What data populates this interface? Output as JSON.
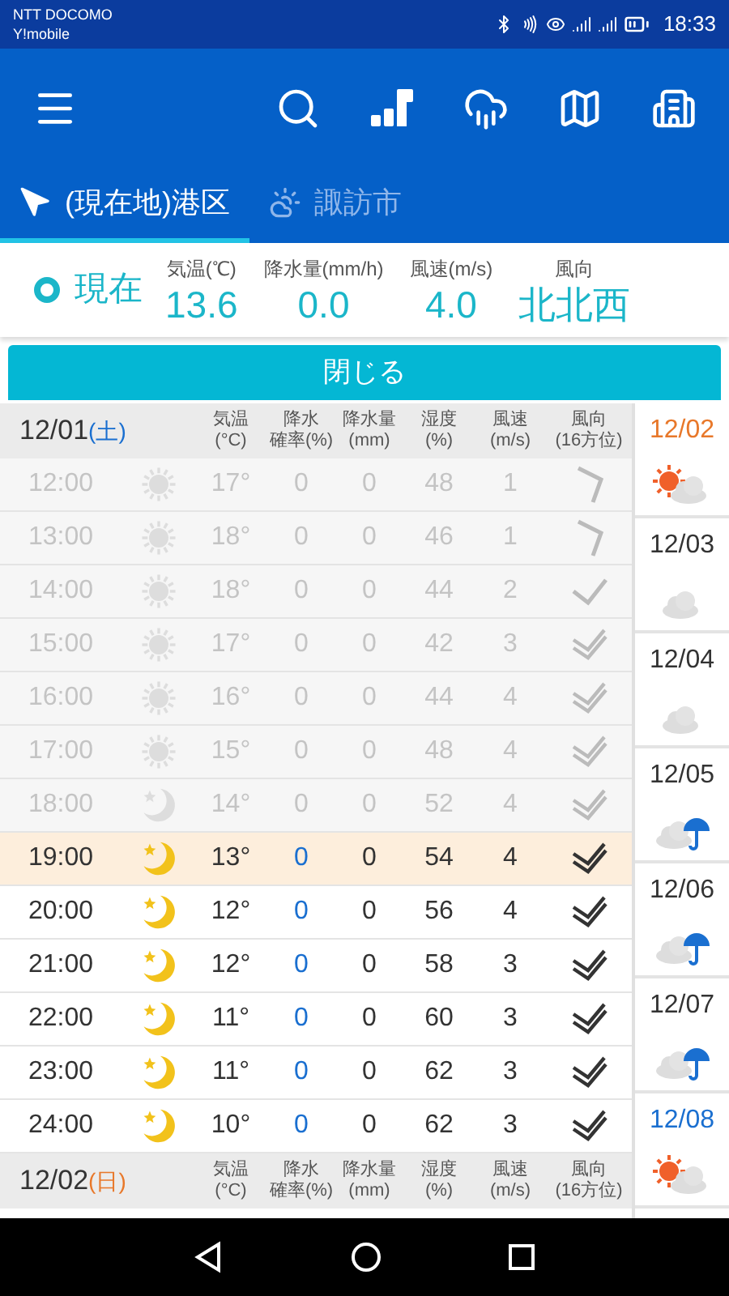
{
  "status_bar": {
    "carriers": [
      "NTT DOCOMO",
      "Y!mobile"
    ],
    "time": "18:33"
  },
  "location_tabs": [
    {
      "label": "(現在地)港区",
      "kind": "location",
      "selected": true
    },
    {
      "label": "諏訪市",
      "kind": "weather",
      "selected": false
    }
  ],
  "current": {
    "label": "現在",
    "metrics": [
      {
        "label": "気温(℃)",
        "value": "13.6"
      },
      {
        "label": "降水量(mm/h)",
        "value": "0.0"
      },
      {
        "label": "風速(m/s)",
        "value": "4.0"
      },
      {
        "label": "風向",
        "value": "北北西"
      }
    ]
  },
  "close_button": "閉じる",
  "table": {
    "heading": {
      "date": "12/01",
      "weekday": "(土)",
      "kind": "sat"
    },
    "columns": [
      [
        "気温",
        "(°C)"
      ],
      [
        "降水",
        "確率(%)"
      ],
      [
        "降水量",
        "(mm)"
      ],
      [
        "湿度",
        "(%)"
      ],
      [
        "風速",
        "(m/s)"
      ],
      [
        "風向",
        "(16方位)"
      ]
    ],
    "rows": [
      {
        "time": "12:00",
        "weather": {
          "kind": "sun"
        },
        "temp": "17°",
        "pop": "0",
        "precip": "0",
        "humidity": "48",
        "wind": "1",
        "wind_direction": {
          "kind": "chevron"
        },
        "past": true,
        "selected": false
      },
      {
        "time": "13:00",
        "weather": {
          "kind": "sun"
        },
        "temp": "18°",
        "pop": "0",
        "precip": "0",
        "humidity": "46",
        "wind": "1",
        "wind_direction": {
          "kind": "chevron"
        },
        "past": true,
        "selected": false
      },
      {
        "time": "14:00",
        "weather": {
          "kind": "sun"
        },
        "temp": "18°",
        "pop": "0",
        "precip": "0",
        "humidity": "44",
        "wind": "2",
        "wind_direction": {
          "kind": "tick"
        },
        "past": true,
        "selected": false
      },
      {
        "time": "15:00",
        "weather": {
          "kind": "sun"
        },
        "temp": "17°",
        "pop": "0",
        "precip": "0",
        "humidity": "42",
        "wind": "3",
        "wind_direction": {
          "kind": "double"
        },
        "past": true,
        "selected": false
      },
      {
        "time": "16:00",
        "weather": {
          "kind": "sun"
        },
        "temp": "16°",
        "pop": "0",
        "precip": "0",
        "humidity": "44",
        "wind": "4",
        "wind_direction": {
          "kind": "double"
        },
        "past": true,
        "selected": false
      },
      {
        "time": "17:00",
        "weather": {
          "kind": "sun"
        },
        "temp": "15°",
        "pop": "0",
        "precip": "0",
        "humidity": "48",
        "wind": "4",
        "wind_direction": {
          "kind": "double"
        },
        "past": true,
        "selected": false
      },
      {
        "time": "18:00",
        "weather": {
          "kind": "moon"
        },
        "temp": "14°",
        "pop": "0",
        "precip": "0",
        "humidity": "52",
        "wind": "4",
        "wind_direction": {
          "kind": "double"
        },
        "past": true,
        "selected": false
      },
      {
        "time": "19:00",
        "weather": {
          "kind": "moon"
        },
        "temp": "13°",
        "pop": "0",
        "precip": "0",
        "humidity": "54",
        "wind": "4",
        "wind_direction": {
          "kind": "double"
        },
        "past": false,
        "selected": true
      },
      {
        "time": "20:00",
        "weather": {
          "kind": "moon"
        },
        "temp": "12°",
        "pop": "0",
        "precip": "0",
        "humidity": "56",
        "wind": "4",
        "wind_direction": {
          "kind": "double"
        },
        "past": false,
        "selected": false
      },
      {
        "time": "21:00",
        "weather": {
          "kind": "moon"
        },
        "temp": "12°",
        "pop": "0",
        "precip": "0",
        "humidity": "58",
        "wind": "3",
        "wind_direction": {
          "kind": "double"
        },
        "past": false,
        "selected": false
      },
      {
        "time": "22:00",
        "weather": {
          "kind": "moon"
        },
        "temp": "11°",
        "pop": "0",
        "precip": "0",
        "humidity": "60",
        "wind": "3",
        "wind_direction": {
          "kind": "double"
        },
        "past": false,
        "selected": false
      },
      {
        "time": "23:00",
        "weather": {
          "kind": "moon"
        },
        "temp": "11°",
        "pop": "0",
        "precip": "0",
        "humidity": "62",
        "wind": "3",
        "wind_direction": {
          "kind": "double"
        },
        "past": false,
        "selected": false
      },
      {
        "time": "24:00",
        "weather": {
          "kind": "moon"
        },
        "temp": "10°",
        "pop": "0",
        "precip": "0",
        "humidity": "62",
        "wind": "3",
        "wind_direction": {
          "kind": "double"
        },
        "past": false,
        "selected": false
      }
    ],
    "next_heading": {
      "date": "12/02",
      "weekday": "(日)",
      "kind": "sun"
    },
    "next_columns": [
      [
        "気温",
        "(°C)"
      ],
      [
        "降水",
        "確率(%)"
      ],
      [
        "降水量",
        "(mm)"
      ],
      [
        "湿度",
        "(%)"
      ],
      [
        "風速",
        "(m/s)"
      ],
      [
        "風向",
        "(16方位)"
      ]
    ]
  },
  "days": [
    {
      "date": "12/02",
      "kind": "sun",
      "weather": {
        "kind": "sun_cloud"
      }
    },
    {
      "date": "12/03",
      "kind": "weekday",
      "weather": {
        "kind": "cloud"
      }
    },
    {
      "date": "12/04",
      "kind": "weekday",
      "weather": {
        "kind": "cloud"
      }
    },
    {
      "date": "12/05",
      "kind": "weekday",
      "weather": {
        "kind": "rain"
      }
    },
    {
      "date": "12/06",
      "kind": "weekday",
      "weather": {
        "kind": "rain"
      }
    },
    {
      "date": "12/07",
      "kind": "weekday",
      "weather": {
        "kind": "rain"
      }
    },
    {
      "date": "12/08",
      "kind": "sat",
      "weather": {
        "kind": "sun_cloud"
      }
    }
  ]
}
